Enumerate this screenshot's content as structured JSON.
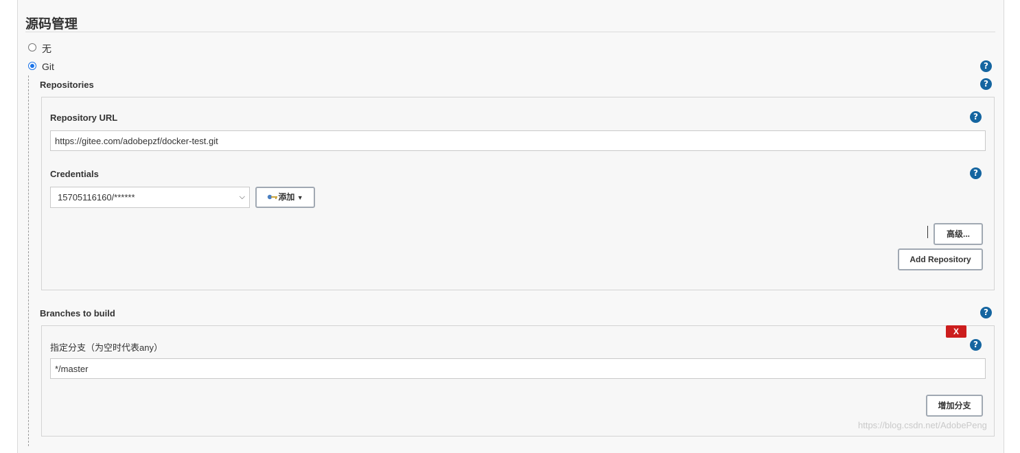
{
  "section": {
    "title": "源码管理"
  },
  "scm_options": [
    {
      "label": "无",
      "selected": false
    },
    {
      "label": "Git",
      "selected": true
    }
  ],
  "repositories": {
    "label": "Repositories",
    "url_label": "Repository URL",
    "url_value": "https://gitee.com/adobepzf/docker-test.git",
    "credentials_label": "Credentials",
    "credentials_value": "15705116160/******",
    "add_button": "添加",
    "advanced_button": "高级...",
    "add_repo_button": "Add Repository"
  },
  "branches": {
    "label": "Branches to build",
    "spec_label": "指定分支（为空时代表any）",
    "spec_value": "*/master",
    "delete_button": "X",
    "add_branch_button": "增加分支"
  },
  "help_glyph": "?",
  "watermark": "https://blog.csdn.net/AdobePeng",
  "colors": {
    "help": "#1565a0",
    "delete": "#cc1d1d",
    "radio_accent": "#1a73e8"
  }
}
